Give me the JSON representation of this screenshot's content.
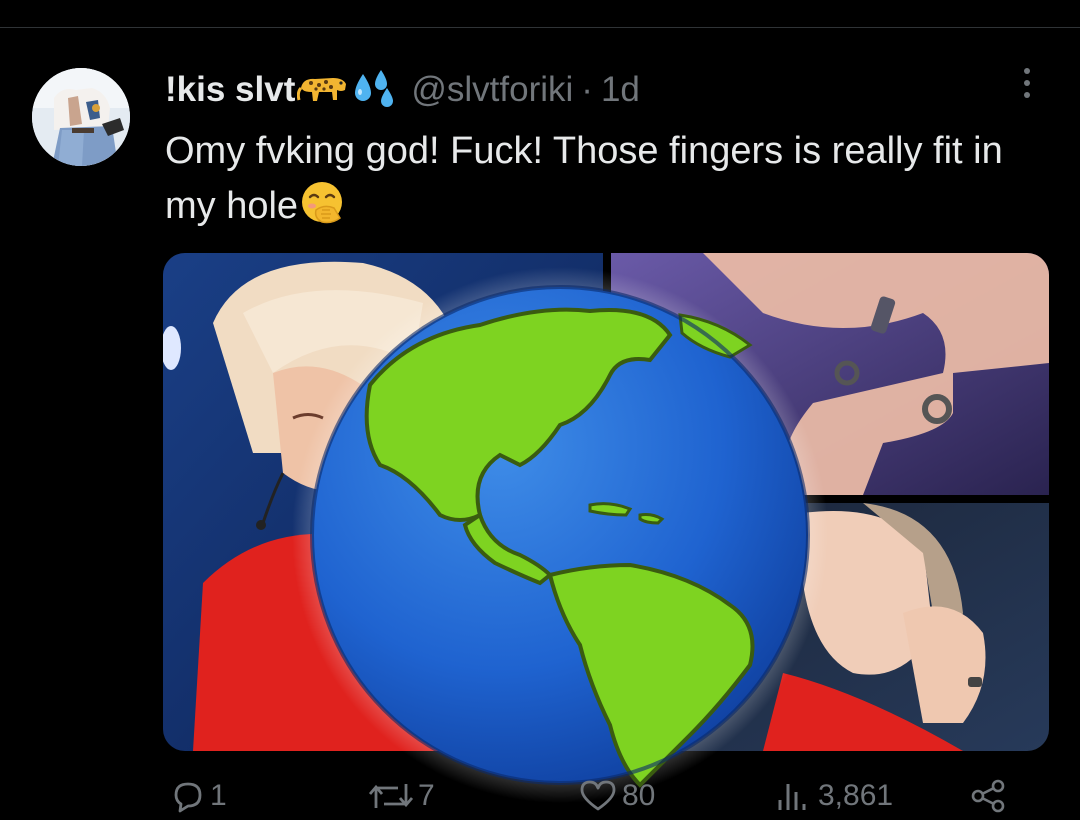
{
  "tweet": {
    "display_name": "!kis slvt",
    "name_emojis": [
      "leopard-emoji",
      "sweat-droplets-emoji"
    ],
    "handle": "@slvtforiki",
    "separator": "·",
    "time": "1d",
    "text": "Omy fvking god! Fuck! Those fingers is really fit in my hole",
    "text_emoji": "face-with-hand-over-mouth-emoji",
    "overlay_emoji": "globe-showing-americas-emoji",
    "media_panels": 3
  },
  "actions": {
    "replies": "1",
    "reposts": "7",
    "likes": "80",
    "views": "3,861"
  },
  "icons": {
    "reply": "speech-bubble-icon",
    "repost": "repost-arrows-icon",
    "like": "heart-icon",
    "views": "bar-chart-icon",
    "share": "share-icon",
    "more": "vertical-ellipsis-icon"
  },
  "colors": {
    "background": "#000000",
    "text": "#e7e9ea",
    "secondary": "#71767b",
    "divider": "#2f3336"
  }
}
